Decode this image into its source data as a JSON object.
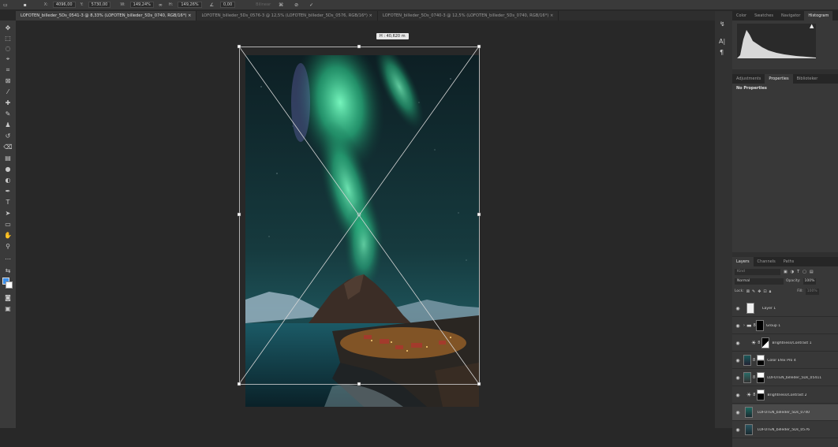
{
  "options_bar": {
    "x_value": "4096,00",
    "y_value": "5730,00",
    "w_value": "149,24%",
    "h_value": "149,26%",
    "angle_value": "0,00",
    "x_label": "X:",
    "y_label": "Y:",
    "w_label": "W:",
    "h_label": "H:",
    "interp_label": "Bilinear"
  },
  "doc_tabs": [
    {
      "label": "LOFOTEN_billeder_5Ds_0541-3 @ 8,33% (LOFOTEN_billeder_5Ds_0740, RGB/16*)",
      "active": true
    },
    {
      "label": "LOFOTEN_billeder_5Ds_0576-3 @ 12,5% (LOFOTEN_billeder_5Ds_0576, RGB/16*)",
      "active": false
    },
    {
      "label": "LOFOTEN_billeder_5Ds_0740-3 @ 12,5% (LOFOTEN_billeder_5Ds_0740, RGB/16*)",
      "active": false
    }
  ],
  "dimension_badge": "H : 40,620 m",
  "top_panel": {
    "tabs": [
      "Color",
      "Swatches",
      "Navigator",
      "Histogram"
    ],
    "active_tab": "Histogram"
  },
  "props_panel": {
    "tabs": [
      "Adjustments",
      "Properties",
      "Biblioteker"
    ],
    "active_tab": "Properties",
    "content": "No Properties"
  },
  "layers_panel": {
    "tabs": [
      "Layers",
      "Channels",
      "Paths"
    ],
    "active_tab": "Layers",
    "search_placeholder": "Kind",
    "blend_mode": "Normal",
    "opacity_label": "Opacity:",
    "opacity_value": "100%",
    "lock_label": "Lock:",
    "fill_label": "Fill:",
    "fill_value": "100%",
    "layers": [
      {
        "name": "Layer 1",
        "type": "pixel"
      },
      {
        "name": "Group 1",
        "type": "group"
      },
      {
        "name": "Brightness/Contrast 1",
        "type": "adjustment"
      },
      {
        "name": "Color Efex Pro 4",
        "type": "pixel-mask"
      },
      {
        "name": "LOFOTEN_billeder_5Ds_05411",
        "type": "pixel-mask"
      },
      {
        "name": "Brightness/Contrast 2",
        "type": "adjustment"
      },
      {
        "name": "LOFOTEN_billeder_5Ds_0740",
        "type": "photo",
        "selected": true
      },
      {
        "name": "LOFOTEN_billeder_5Ds_0576",
        "type": "photo"
      }
    ]
  },
  "colors": {
    "accent_blue": "#3b8ee8",
    "aurora_green": "#3fe0a0",
    "panel_bg": "#383838"
  }
}
